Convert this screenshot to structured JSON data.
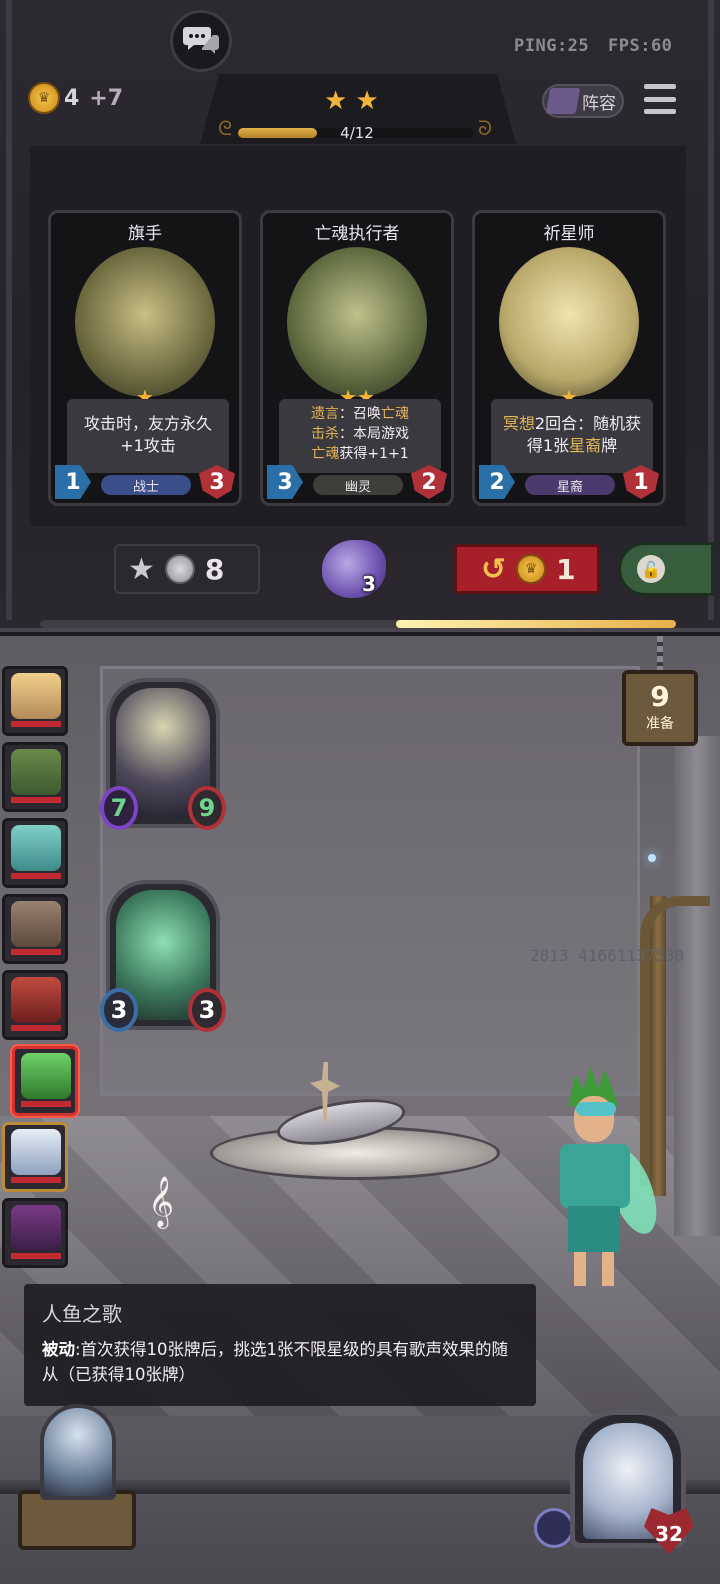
{
  "top": {
    "ping": "PING:25",
    "fps": "FPS:60",
    "gold": "4",
    "gold_income": "+7",
    "lineup_label": "阵容"
  },
  "tavern": {
    "tier_stars": 2,
    "xp_text": "4/12",
    "xp_fraction": 0.333
  },
  "cards": [
    {
      "name": "旗手",
      "stars": 1,
      "attack": "1",
      "health": "3",
      "tribe": "战士",
      "desc_line1": "攻击时，友方永久",
      "desc_line2": "+1攻击",
      "tribe_color": "#3a4f8a"
    },
    {
      "name": "亡魂执行者",
      "stars": 2,
      "attack": "3",
      "health": "2",
      "tribe": "幽灵",
      "desc_l1a": "遗言",
      "desc_l1b": "：召唤",
      "desc_l1c": "亡魂",
      "desc_l2a": "击杀",
      "desc_l2b": "：本局游戏",
      "desc_l3a": "亡魂",
      "desc_l3b": "获得+1+1",
      "tribe_color": "#3e3f3a"
    },
    {
      "name": "祈星师",
      "stars": 1,
      "attack": "2",
      "health": "1",
      "tribe": "星裔",
      "desc_l1a": "冥想",
      "desc_l1b": "2回合：随机获",
      "desc_l2a": "得1张",
      "desc_l2b": "星裔",
      "desc_l2c": "牌",
      "tribe_color": "#4a3a6e"
    }
  ],
  "shop_bar": {
    "upgrade_cost": "8",
    "freeze_count": "3",
    "refresh_cost": "1"
  },
  "board": {
    "ready_count": "9",
    "ready_label": "准备",
    "minions": [
      {
        "attack": "7",
        "health": "9"
      },
      {
        "attack": "3",
        "health": "3"
      }
    ]
  },
  "tooltip": {
    "title": "人鱼之歌",
    "keyword": "被动",
    "text": ":首次获得10张牌后，挑选1张不限星级的具有歌声效果的随从（已获得10张牌）"
  },
  "player": {
    "health": "32",
    "id": "2813 41661137530"
  },
  "colors": {
    "accent_gold": "#f2b53a",
    "refresh_red": "#a71f28",
    "lock_green": "#385d3d",
    "attack_blue": "#2b6fa8",
    "health_red": "#b03138"
  }
}
